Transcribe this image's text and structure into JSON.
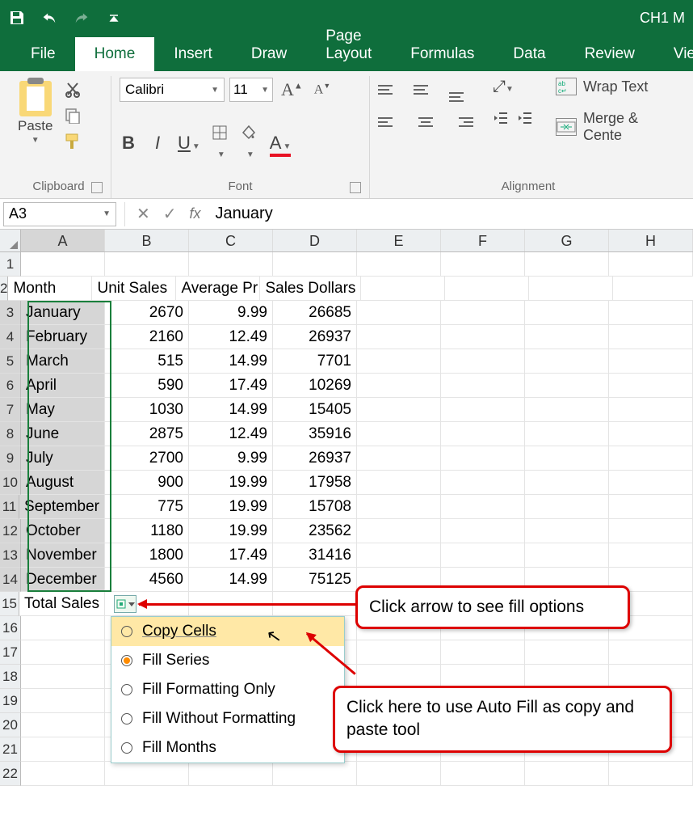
{
  "docTitle": "CH1 M",
  "tabs": [
    "File",
    "Home",
    "Insert",
    "Draw",
    "Page Layout",
    "Formulas",
    "Data",
    "Review",
    "View"
  ],
  "activeTab": "Home",
  "clipboard": {
    "paste": "Paste",
    "label": "Clipboard"
  },
  "font": {
    "name": "Calibri",
    "size": "11",
    "label": "Font"
  },
  "alignment": {
    "wrap": "Wrap Text",
    "merge": "Merge & Cente",
    "label": "Alignment"
  },
  "namebox": "A3",
  "formula": "January",
  "columns": [
    "A",
    "B",
    "C",
    "D",
    "E",
    "F",
    "G",
    "H"
  ],
  "headers": {
    "A": "Month",
    "B": "Unit Sales",
    "C": "Average Pr",
    "D": "Sales Dollars"
  },
  "monthRows": [
    {
      "r": 3,
      "m": "January",
      "u": "2670",
      "p": "9.99",
      "s": "26685"
    },
    {
      "r": 4,
      "m": "February",
      "u": "2160",
      "p": "12.49",
      "s": "26937"
    },
    {
      "r": 5,
      "m": "March",
      "u": "515",
      "p": "14.99",
      "s": "7701"
    },
    {
      "r": 6,
      "m": "April",
      "u": "590",
      "p": "17.49",
      "s": "10269"
    },
    {
      "r": 7,
      "m": "May",
      "u": "1030",
      "p": "14.99",
      "s": "15405"
    },
    {
      "r": 8,
      "m": "June",
      "u": "2875",
      "p": "12.49",
      "s": "35916"
    },
    {
      "r": 9,
      "m": "July",
      "u": "2700",
      "p": "9.99",
      "s": "26937"
    },
    {
      "r": 10,
      "m": "August",
      "u": "900",
      "p": "19.99",
      "s": "17958"
    },
    {
      "r": 11,
      "m": "September",
      "u": "775",
      "p": "19.99",
      "s": "15708"
    },
    {
      "r": 12,
      "m": "October",
      "u": "1180",
      "p": "19.99",
      "s": "23562"
    },
    {
      "r": 13,
      "m": "November",
      "u": "1800",
      "p": "17.49",
      "s": "31416"
    },
    {
      "r": 14,
      "m": "December",
      "u": "4560",
      "p": "14.99",
      "s": "75125"
    }
  ],
  "totalLabel": "Total Sales",
  "autofill": {
    "items": [
      "Copy Cells",
      "Fill Series",
      "Fill Formatting Only",
      "Fill Without Formatting",
      "Fill Months"
    ],
    "hoverIndex": 0,
    "selectedIndex": 1
  },
  "callout1": "Click arrow to see fill options",
  "callout2": "Click here to use Auto Fill as copy and paste tool"
}
